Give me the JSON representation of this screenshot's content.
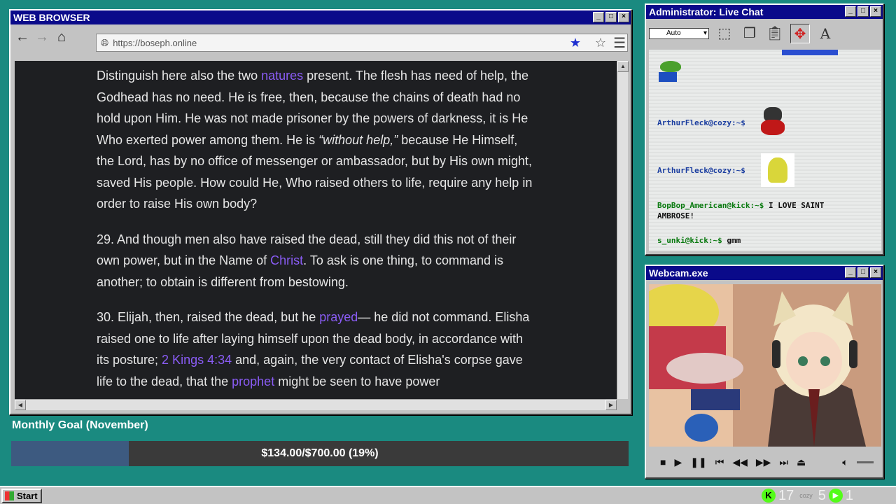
{
  "browser": {
    "title": "WEB BROWSER",
    "url": "https://boseph.online",
    "paragraphs": [
      {
        "parts": [
          {
            "text": "Distinguish here also the two "
          },
          {
            "text": "natures",
            "link": true
          },
          {
            "text": " present. The flesh has need of help, the Godhead has no need. He is free, then, because the chains of death had no hold upon Him. He was not made prisoner by the powers of darkness, it is He Who exerted power among them. He is "
          },
          {
            "text": "“without help,”",
            "italic": true
          },
          {
            "text": " because He Himself, the Lord, has by no office of messenger or ambassador, but by His own might, saved His people. How could He, Who raised others to life, require any help in order to raise His own body?"
          }
        ]
      },
      {
        "parts": [
          {
            "text": "29. And though men also have raised the dead, still they did this not of their own power, but in the Name of "
          },
          {
            "text": "Christ",
            "link": true
          },
          {
            "text": ". To ask is one thing, to command is another; to obtain is different from bestowing."
          }
        ]
      },
      {
        "parts": [
          {
            "text": "30. Elijah, then, raised the dead, but he "
          },
          {
            "text": "prayed",
            "link": true
          },
          {
            "text": "— he did not command. Elisha raised one to life after laying himself upon the dead body, in accordance with its posture; "
          },
          {
            "text": "2 Kings 4:34",
            "link": true
          },
          {
            "text": " and, again, the very contact of Elisha's corpse gave life to the dead, that the "
          },
          {
            "text": "prophet",
            "link": true
          },
          {
            "text": " might be seen to have power"
          }
        ]
      }
    ]
  },
  "goal": {
    "title": "Monthly Goal (November)",
    "progress_text": "$134.00/$700.00 (19%)",
    "progress_fraction": 0.19
  },
  "chat": {
    "title": "Administrator: Live Chat",
    "select_value": "Auto",
    "lines": [
      {
        "user": "ArthurFleck@cozy:~$",
        "message": "",
        "color": "blue"
      },
      {
        "user": "ArthurFleck@cozy:~$",
        "message": "",
        "color": "blue"
      },
      {
        "user": "BopBop_American@kick:~$",
        "message": "I LOVE SAINT",
        "color": "green"
      },
      {
        "user": "",
        "message": "AMBROSE!",
        "color": "green"
      },
      {
        "user": "s_unki@kick:~$",
        "message": "gmm",
        "color": "green"
      }
    ]
  },
  "webcam": {
    "title": "Webcam.exe"
  },
  "taskbar": {
    "start_label": "Start",
    "count_a": "17",
    "count_b": "5",
    "count_c": "1",
    "cozy_label": "cozy"
  }
}
